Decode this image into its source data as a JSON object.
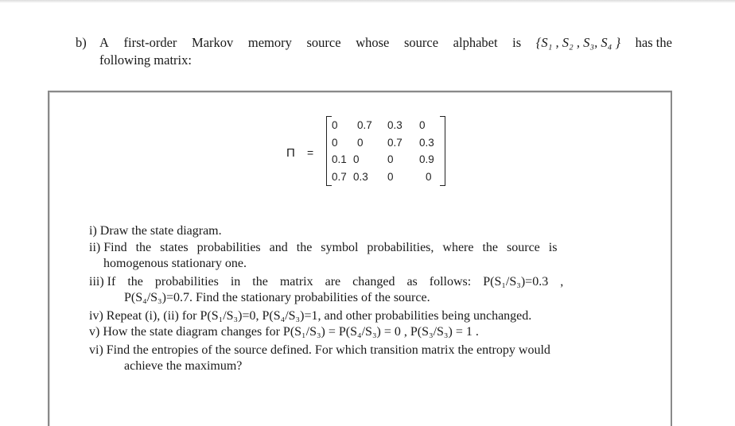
{
  "intro": {
    "label": "b)",
    "line1_words": [
      "A",
      "first-order",
      "Markov",
      "memory",
      "source",
      "whose",
      "source",
      "alphabet",
      "is"
    ],
    "alphabet": "{S₁ , S₂ , S₃, S₄ }",
    "line1_tail": "has the",
    "line2": "following matrix:"
  },
  "matrix": {
    "symbol": "Π",
    "equals": "=",
    "rows": [
      [
        "0",
        "0.7",
        "0.3",
        "0"
      ],
      [
        "0",
        "0",
        "0.7",
        "0.3"
      ],
      [
        "0.1",
        "0",
        "0",
        "0.9"
      ],
      [
        "0.7",
        "0.3",
        "0",
        "0"
      ]
    ]
  },
  "questions": [
    {
      "num": "i)",
      "lines": [
        "Draw the state diagram."
      ]
    },
    {
      "num": "ii)",
      "lines": [
        "Find the states probabilities and the symbol probabilities, where the source is",
        "homogenous stationary one."
      ]
    },
    {
      "num": "iii)",
      "lines": [
        "If the probabilities in the matrix are changed as follows: P(S₁/S₃)=0.3 ,",
        "P(S₄/S₃)=0.7. Find the stationary probabilities of the source."
      ]
    },
    {
      "num": "iv)",
      "lines": [
        "Repeat (i), (ii) for P(S₁/S₃)=0, P(S₄/S₃)=1, and other probabilities being unchanged."
      ]
    },
    {
      "num": "v)",
      "lines": [
        "How the state diagram changes for P(S₁/S₃) = P(S₄/S₃) = 0 , P(S₃/S₃) = 1 ."
      ]
    },
    {
      "num": "vi)",
      "lines": [
        "Find the entropies of the source defined. For which transition matrix the entropy would",
        "achieve the maximum?"
      ]
    }
  ]
}
